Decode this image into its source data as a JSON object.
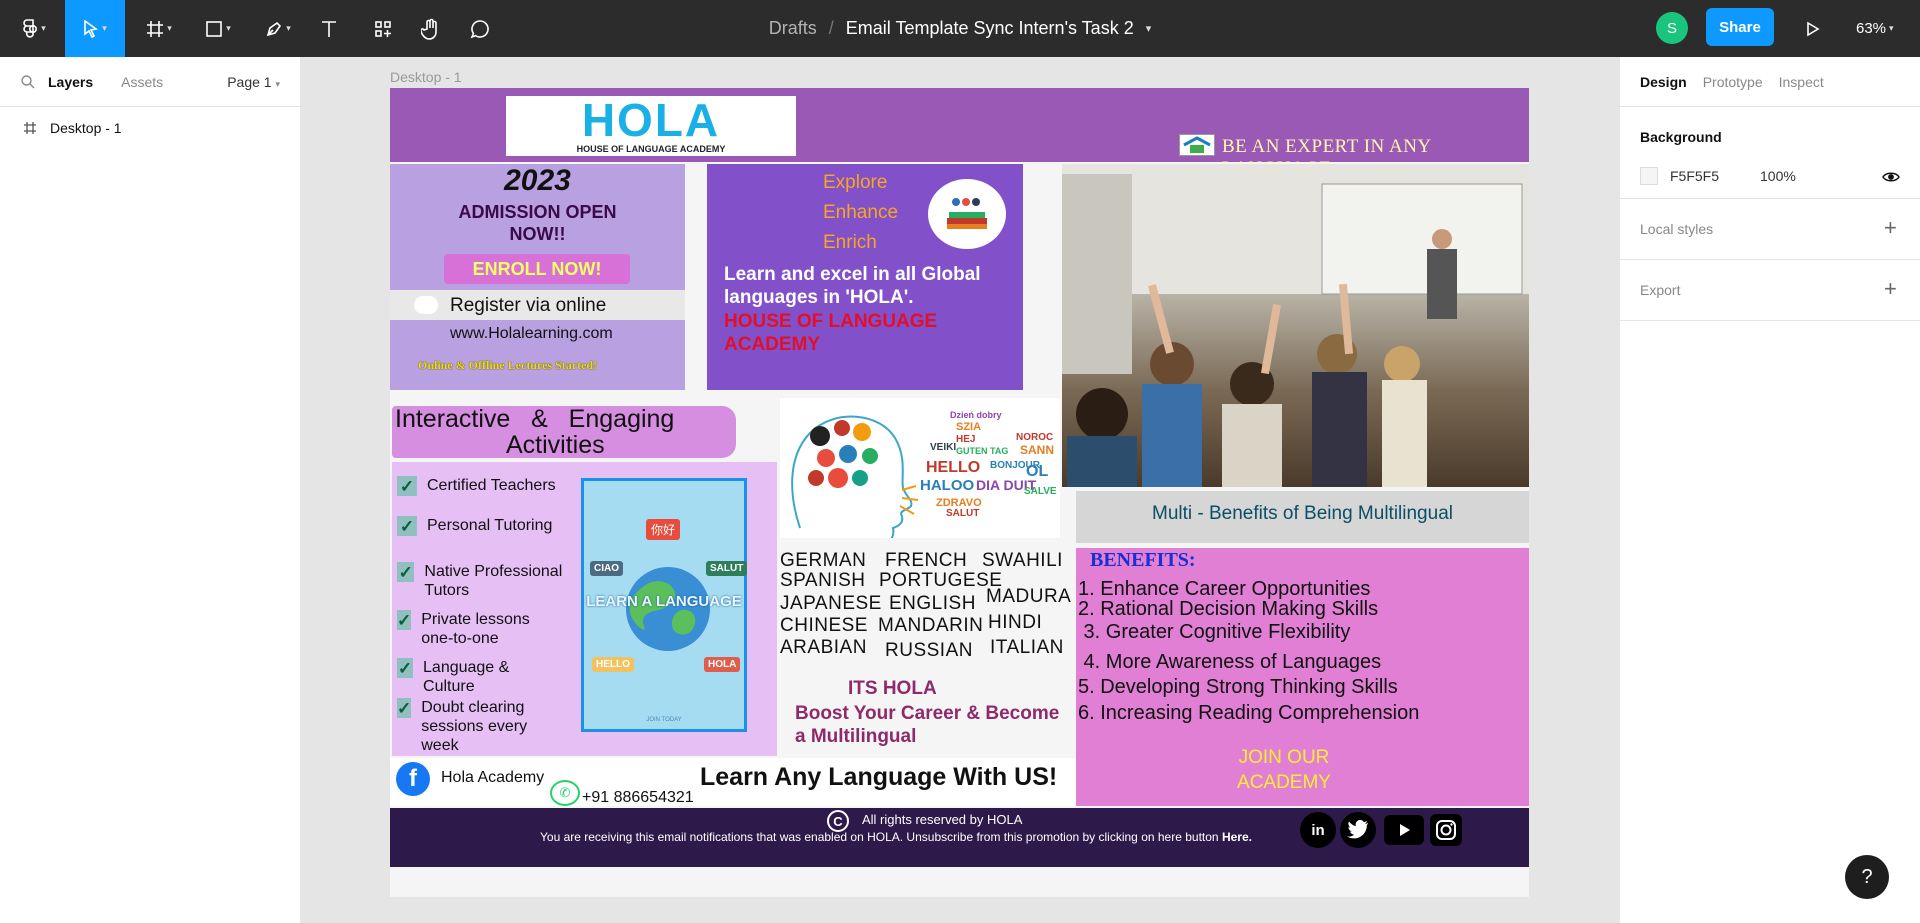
{
  "toolbar": {
    "breadcrumb_root": "Drafts",
    "breadcrumb_separator": "/",
    "file_name": "Email Template Sync Intern's Task 2",
    "avatar_initial": "S",
    "share_label": "Share",
    "zoom_level": "63%"
  },
  "left_panel": {
    "tabs": [
      "Layers",
      "Assets"
    ],
    "page_selector": "Page 1",
    "layers": [
      "Desktop - 1"
    ]
  },
  "right_panel": {
    "tabs": [
      "Design",
      "Prototype",
      "Inspect"
    ],
    "background_title": "Background",
    "background_hex": "F5F5F5",
    "background_opacity": "100%",
    "local_styles": "Local styles",
    "export": "Export"
  },
  "canvas": {
    "frame_label": "Desktop - 1",
    "help": "?"
  },
  "email": {
    "logo_text": "HOLA",
    "logo_sub": "HOUSE OF LANGUAGE ACADEMY",
    "tagline": "BE AN EXPERT IN ANY LANGUAGE",
    "year": "2023",
    "admission": "ADMISSION OPEN NOW!!",
    "enroll": "ENROLL NOW!",
    "register": "Register via online",
    "website": "www.Holalearning.com",
    "lectures": "Online & Offline Lectures Started!",
    "explore_words": [
      "Explore",
      "Enhance",
      "Enrich"
    ],
    "learn_text": "Learn and excel in all Global languages in  'HOLA'.",
    "academy_name": "HOUSE OF LANGUAGE ACADEMY",
    "activities_title_1": "Interactive   &   Engaging",
    "activities_title_2": "Activities",
    "features": [
      "Certified Teachers",
      "Personal Tutoring",
      "Native Professional Tutors",
      "Private lessons one-to-one",
      " Language & Culture",
      "Doubt clearing sessions every week"
    ],
    "poster_text": "LEARN A LANGUAGE",
    "poster_bubbles": [
      "你好",
      "CIAO",
      "SALUT",
      "HELLO",
      "HOLA"
    ],
    "poster_footer": "JOIN TODAY",
    "languages": [
      [
        "GERMAN",
        "FRENCH",
        "SWAHILI"
      ],
      [
        "SPANISH",
        "PORTUGESE",
        "MADURA"
      ],
      [
        "JAPANESE",
        "ENGLISH",
        ""
      ],
      [
        "CHINESE",
        "MANDARIN",
        "HINDI"
      ],
      [
        "ARABIAN",
        "RUSSIAN",
        "ITALIAN"
      ]
    ],
    "its_hola": "ITS HOLA",
    "boost": "Boost Your Career & Become a Multilingual",
    "benefits_header": "Multi - Benefits of Being Multilingual",
    "benefits_title": "BENEFITS:",
    "benefits": [
      "1. Enhance Career Opportunities",
      "2. Rational Decision Making Skills",
      " 3. Greater Cognitive Flexibility",
      " 4. More Awareness of Languages",
      "5. Developing Strong Thinking Skills",
      "6. Increasing Reading Comprehension"
    ],
    "join": "JOIN OUR ACADEMY",
    "facebook_name": "Hola Academy",
    "phone": "+91 886654321",
    "learn_any": "Learn Any Language With US!",
    "copyright": "All rights reserved by HOLA",
    "unsubscribe": "You are receiving this email notifications that was enabled on HOLA. Unsubscribe from this promotion by clicking on here button",
    "here": "Here."
  },
  "colors": {
    "toolbar_bg": "#2c2c2c",
    "accent_blue": "#0d99ff",
    "banner_purple": "#9b59b6",
    "pink": "#e07fd4",
    "footer_purple": "#2e1a4a"
  }
}
